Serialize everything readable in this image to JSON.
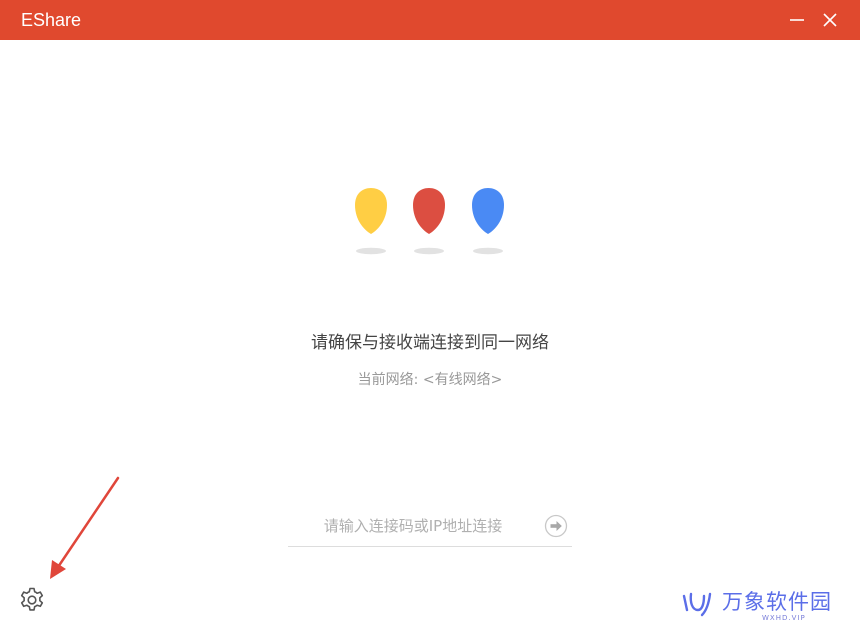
{
  "window": {
    "title": "EShare",
    "accent_color": "#e0492e"
  },
  "titlebar": {
    "minimize_icon": "minimize-icon",
    "close_icon": "close-icon"
  },
  "illustration": {
    "drop_colors": [
      "#ffce44",
      "#dc4e41",
      "#4a8af4"
    ]
  },
  "main": {
    "headline": "请确保与接收端连接到同一网络",
    "network_label": "当前网络:",
    "network_value": "<有线网络>"
  },
  "connect": {
    "input_value": "",
    "input_placeholder": "请输入连接码或IP地址连接",
    "go_icon": "arrow-right-circle-icon"
  },
  "footer": {
    "settings_icon": "gear-icon"
  },
  "watermark": {
    "brand": "万象软件园",
    "sub": "WXHD.VIP"
  }
}
